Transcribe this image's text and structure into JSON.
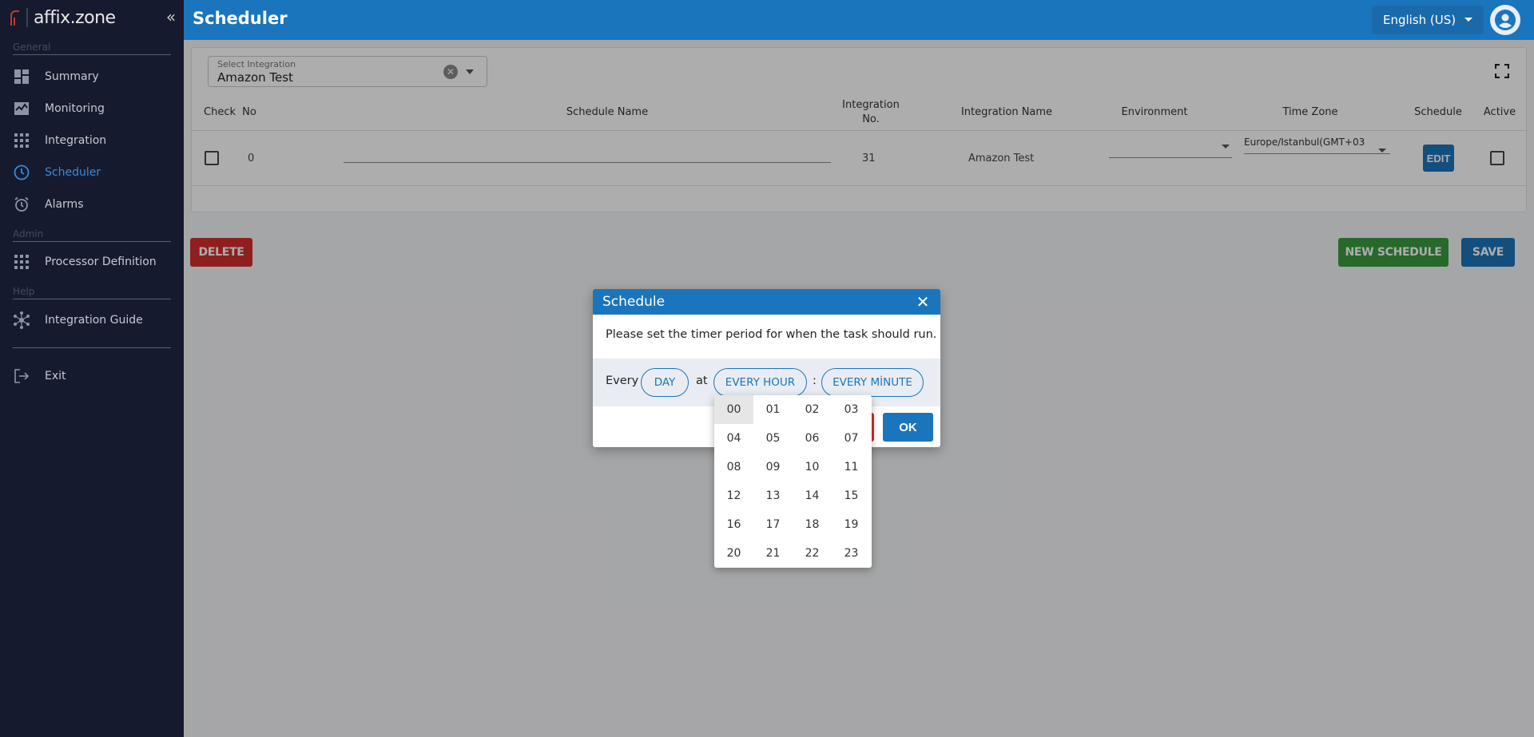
{
  "app": {
    "logo_text": "affix.zone",
    "page_title": "Scheduler"
  },
  "sidebar": {
    "sections": {
      "general": "General",
      "admin": "Admin",
      "help": "Help"
    },
    "items": [
      {
        "label": "Summary",
        "icon": "dashboard-icon"
      },
      {
        "label": "Monitoring",
        "icon": "monitoring-icon"
      },
      {
        "label": "Integration",
        "icon": "grid-icon"
      },
      {
        "label": "Scheduler",
        "icon": "clock-icon",
        "active": true
      },
      {
        "label": "Alarms",
        "icon": "alarm-icon"
      },
      {
        "label": "Processor Definition",
        "icon": "grid-icon"
      },
      {
        "label": "Integration Guide",
        "icon": "network-icon"
      },
      {
        "label": "Exit",
        "icon": "exit-icon"
      }
    ]
  },
  "header": {
    "language": "English (US)"
  },
  "integration_select": {
    "label": "Select Integration",
    "value": "Amazon Test"
  },
  "table": {
    "headers": {
      "check": "Check",
      "no": "No",
      "schedule_name": "Schedule Name",
      "integration_no_line1": "Integration",
      "integration_no_line2": "No.",
      "integration_name": "Integration Name",
      "environment": "Environment",
      "time_zone": "Time Zone",
      "schedule": "Schedule",
      "active": "Active"
    },
    "rows": [
      {
        "no": "0",
        "schedule_name": "",
        "integration_no": "31",
        "integration_name": "Amazon Test",
        "environment": "",
        "time_zone": "Europe/Istanbul(GMT+03",
        "schedule_button": "EDIT"
      }
    ]
  },
  "actions": {
    "delete": "DELETE",
    "new_schedule": "NEW SCHEDULE",
    "save": "SAVE"
  },
  "dialog": {
    "title": "Schedule",
    "message": "Please set the timer period for when the task should run.",
    "every_label": "Every",
    "at_label": "at",
    "colon": ":",
    "period_value": "DAY",
    "hour_value": "EVERY HOUR",
    "minute_value": "EVERY MİNUTE",
    "ok": "OK"
  },
  "hour_menu": {
    "selected": "00",
    "options": [
      "00",
      "01",
      "02",
      "03",
      "04",
      "05",
      "06",
      "07",
      "08",
      "09",
      "10",
      "11",
      "12",
      "13",
      "14",
      "15",
      "16",
      "17",
      "18",
      "19",
      "20",
      "21",
      "22",
      "23"
    ]
  },
  "colors": {
    "primary": "#1b75bc",
    "sidebar_bg": "#161a2e",
    "danger": "#d32f2f",
    "success": "#3a9b3f",
    "active_nav": "#3b89d8"
  }
}
